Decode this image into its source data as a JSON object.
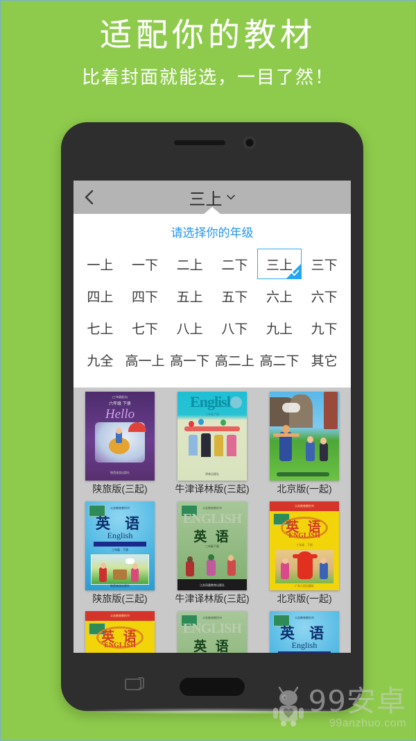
{
  "promo": {
    "title": "适配你的教材",
    "subtitle": "比着封面就能选，一目了然！",
    "background_color": "#8ecb4c",
    "text_color": "#ffffff"
  },
  "app": {
    "header": {
      "back_icon": "chevron-left-icon",
      "title": "三上",
      "dropdown_icon": "chevron-down-icon",
      "background_color": "#b4b4b4"
    },
    "grade_picker": {
      "heading": "请选择你的年级",
      "heading_color": "#2196f3",
      "selected": "三上",
      "accent_color": "#22a5f2",
      "check_icon": "check-icon",
      "grades": [
        "一上",
        "一下",
        "二上",
        "二下",
        "三上",
        "三下",
        "四上",
        "四下",
        "五上",
        "五下",
        "六上",
        "六下",
        "七上",
        "七下",
        "八上",
        "八下",
        "九上",
        "九下",
        "九全",
        "高一上",
        "高一下",
        "高二上",
        "高二下",
        "其它"
      ]
    },
    "book_grid": {
      "background_color": "#c9c9c9",
      "rows": [
        [
          {
            "label": "陕旅版(三起)",
            "cover": "purple",
            "cn": "",
            "en": ""
          },
          {
            "label": "牛津译林版(三起)",
            "cover": "teal",
            "cn": "",
            "en": "English"
          },
          {
            "label": "北京版(一起)",
            "cover": "scene",
            "cn": "",
            "en": ""
          }
        ],
        [
          {
            "label": "陕旅版(三起)",
            "cover": "blue",
            "cn": "英 语",
            "en": "English"
          },
          {
            "label": "牛津译林版(三起)",
            "cover": "green",
            "cn": "英 语",
            "en": "ENGLISH"
          },
          {
            "label": "北京版(一起)",
            "cover": "yellow",
            "cn": "英 语",
            "en": "ENGLISH"
          }
        ],
        [
          {
            "label": "",
            "cover": "yellow",
            "cn": "英 语",
            "en": "ENGLISH"
          },
          {
            "label": "",
            "cover": "green",
            "cn": "英 语",
            "en": "ENGLISH"
          },
          {
            "label": "",
            "cover": "blue",
            "cn": "英 语",
            "en": "English"
          }
        ]
      ]
    },
    "navbar": {
      "recents_icon": "recents-square-icon",
      "home_icon": "home-pill-icon"
    }
  },
  "watermark": {
    "logo_icon": "android-robot-heart-icon",
    "brand": "99安卓",
    "domain": "99anzhuo.com"
  }
}
